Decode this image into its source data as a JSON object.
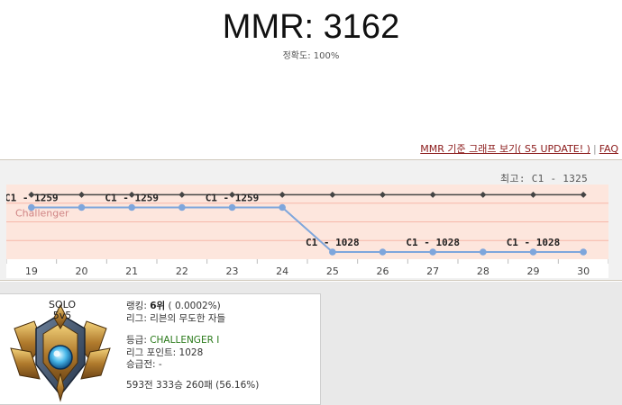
{
  "header": {
    "mmr_label": "MMR: 3162",
    "accuracy_label": "정확도:",
    "accuracy_value": "100%"
  },
  "links": {
    "graph_link": "MMR 기준 그래프 보기( S5 UPDATE! )",
    "separator": "|",
    "faq_link": "FAQ"
  },
  "best": {
    "label": "최고:",
    "value": "C1 - 1325"
  },
  "chart_data": {
    "type": "line",
    "x": [
      "19",
      "20",
      "21",
      "22",
      "23",
      "24",
      "25",
      "26",
      "27",
      "28",
      "29",
      "30"
    ],
    "series": [
      {
        "name": "",
        "values": [
          1325,
          1325,
          1325,
          1325,
          1325,
          1325,
          1325,
          1325,
          1325,
          1325,
          1325,
          1325
        ],
        "color": "#444444"
      },
      {
        "name": "",
        "values": [
          1259,
          1259,
          1259,
          1259,
          1259,
          1259,
          1028,
          1028,
          1028,
          1028,
          1028,
          1028
        ],
        "color": "#7ea6dc"
      }
    ],
    "point_labels": [
      {
        "index": 0,
        "text": "C1 - 1259"
      },
      {
        "index": 2,
        "text": "C1 - 1259"
      },
      {
        "index": 4,
        "text": "C1 - 1259"
      },
      {
        "index": 6,
        "text": "C1 - 1028"
      },
      {
        "index": 8,
        "text": "C1 - 1028"
      },
      {
        "index": 10,
        "text": "C1 - 1028"
      }
    ],
    "band_label": "Challenger",
    "ylim": [
      1000,
      1350
    ],
    "grid": true,
    "colors": {
      "band": "#fde6dd",
      "grid": "#f6b8aa",
      "axis_bg": "#ffffff"
    }
  },
  "profile": {
    "queue_line1": "SOLO",
    "queue_line2": "5v5",
    "rank_label": "랭킹:",
    "rank_value": "6위",
    "rank_pct": "( 0.0002%)",
    "league_label": "리그:",
    "league_value": "리븐의 무도한 자들",
    "tier_label": "등급:",
    "tier_value": "CHALLENGER I",
    "lp_label": "리그 포인트:",
    "lp_value": "1028",
    "promo_label": "승급전:",
    "promo_value": "-",
    "record": "593전 333승 260패 (56.16%)",
    "emblem_icon": "challenger-emblem-icon"
  }
}
